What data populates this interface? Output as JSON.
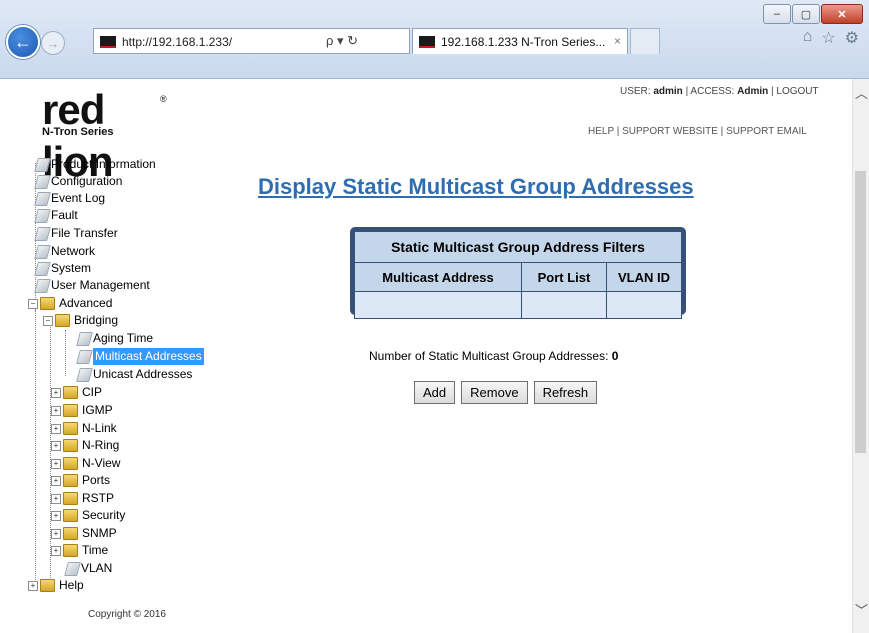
{
  "browser": {
    "url": "http://192.168.1.233/",
    "search_glyph": "ρ ▾ ↻",
    "tab_title": "192.168.1.233 N-Tron Series...",
    "tab_close": "×",
    "window_buttons": [
      "–",
      "▢",
      "✕"
    ],
    "toolbar_icons": [
      "home-icon",
      "star-icon",
      "gear-icon"
    ]
  },
  "header": {
    "logo_text": "red lion",
    "logo_sub": "N-Tron Series",
    "user_label": "USER:",
    "user": "admin",
    "access_label": "ACCESS:",
    "access": "Admin",
    "logout": "LOGOUT",
    "help": "HELP",
    "support_website": "SUPPORT WEBSITE",
    "support_email": "SUPPORT EMAIL",
    "separator": "|"
  },
  "tree": {
    "product_information": "Product Information",
    "configuration": "Configuration",
    "event_log": "Event Log",
    "fault": "Fault",
    "file_transfer": "File Transfer",
    "network": "Network",
    "system": "System",
    "user_management": "User Management",
    "advanced": "Advanced",
    "bridging": "Bridging",
    "aging_time": "Aging Time",
    "multicast_addresses": "Multicast Addresses",
    "unicast_addresses": "Unicast Addresses",
    "cip": "CIP",
    "igmp": "IGMP",
    "n_link": "N-Link",
    "n_ring": "N-Ring",
    "n_view": "N-View",
    "ports": "Ports",
    "rstp": "RSTP",
    "security": "Security",
    "snmp": "SNMP",
    "time": "Time",
    "vlan": "VLAN",
    "help": "Help"
  },
  "copyright": "Copyright © 2016",
  "main": {
    "title": "Display Static Multicast Group Addresses",
    "table": {
      "caption": "Static Multicast Group Address Filters",
      "columns": [
        "Multicast Address",
        "Port List",
        "VLAN ID"
      ],
      "rows": [
        [
          "",
          "",
          ""
        ]
      ]
    },
    "count_label": "Number of Static Multicast Group Addresses:",
    "count_value": "0",
    "buttons": {
      "add": "Add",
      "remove": "Remove",
      "refresh": "Refresh"
    }
  }
}
